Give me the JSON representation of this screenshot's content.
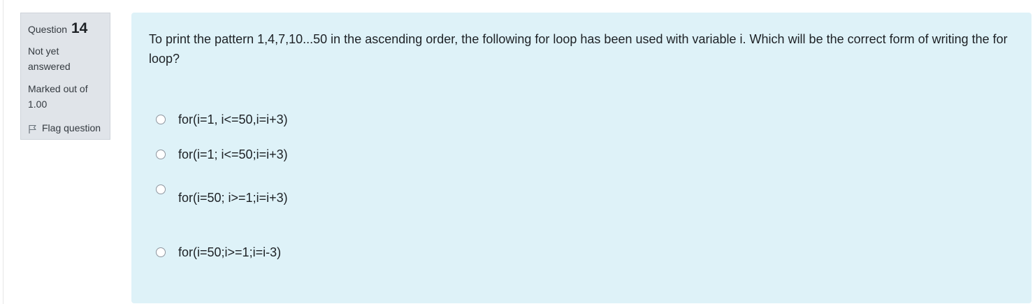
{
  "question_info": {
    "prefix": "Question",
    "number": "14",
    "state": "Not yet answered",
    "grade": "Marked out of 1.00",
    "flag_label": "Flag question"
  },
  "question": {
    "text": "To print the pattern 1,4,7,10...50 in the ascending order, the following for loop has been used with variable i. Which will be the correct form of writing the for loop?",
    "options": [
      {
        "label": "for(i=1, i<=50,i=i+3)"
      },
      {
        "label": "for(i=1; i<=50;i=i+3)"
      },
      {
        "label": "for(i=50; i>=1;i=i+3)"
      },
      {
        "label": "for(i=50;i>=1;i=i-3)"
      }
    ]
  },
  "colors": {
    "info_bg": "#e0e4e9",
    "content_bg": "#def2f8",
    "text": "#1d2125"
  }
}
